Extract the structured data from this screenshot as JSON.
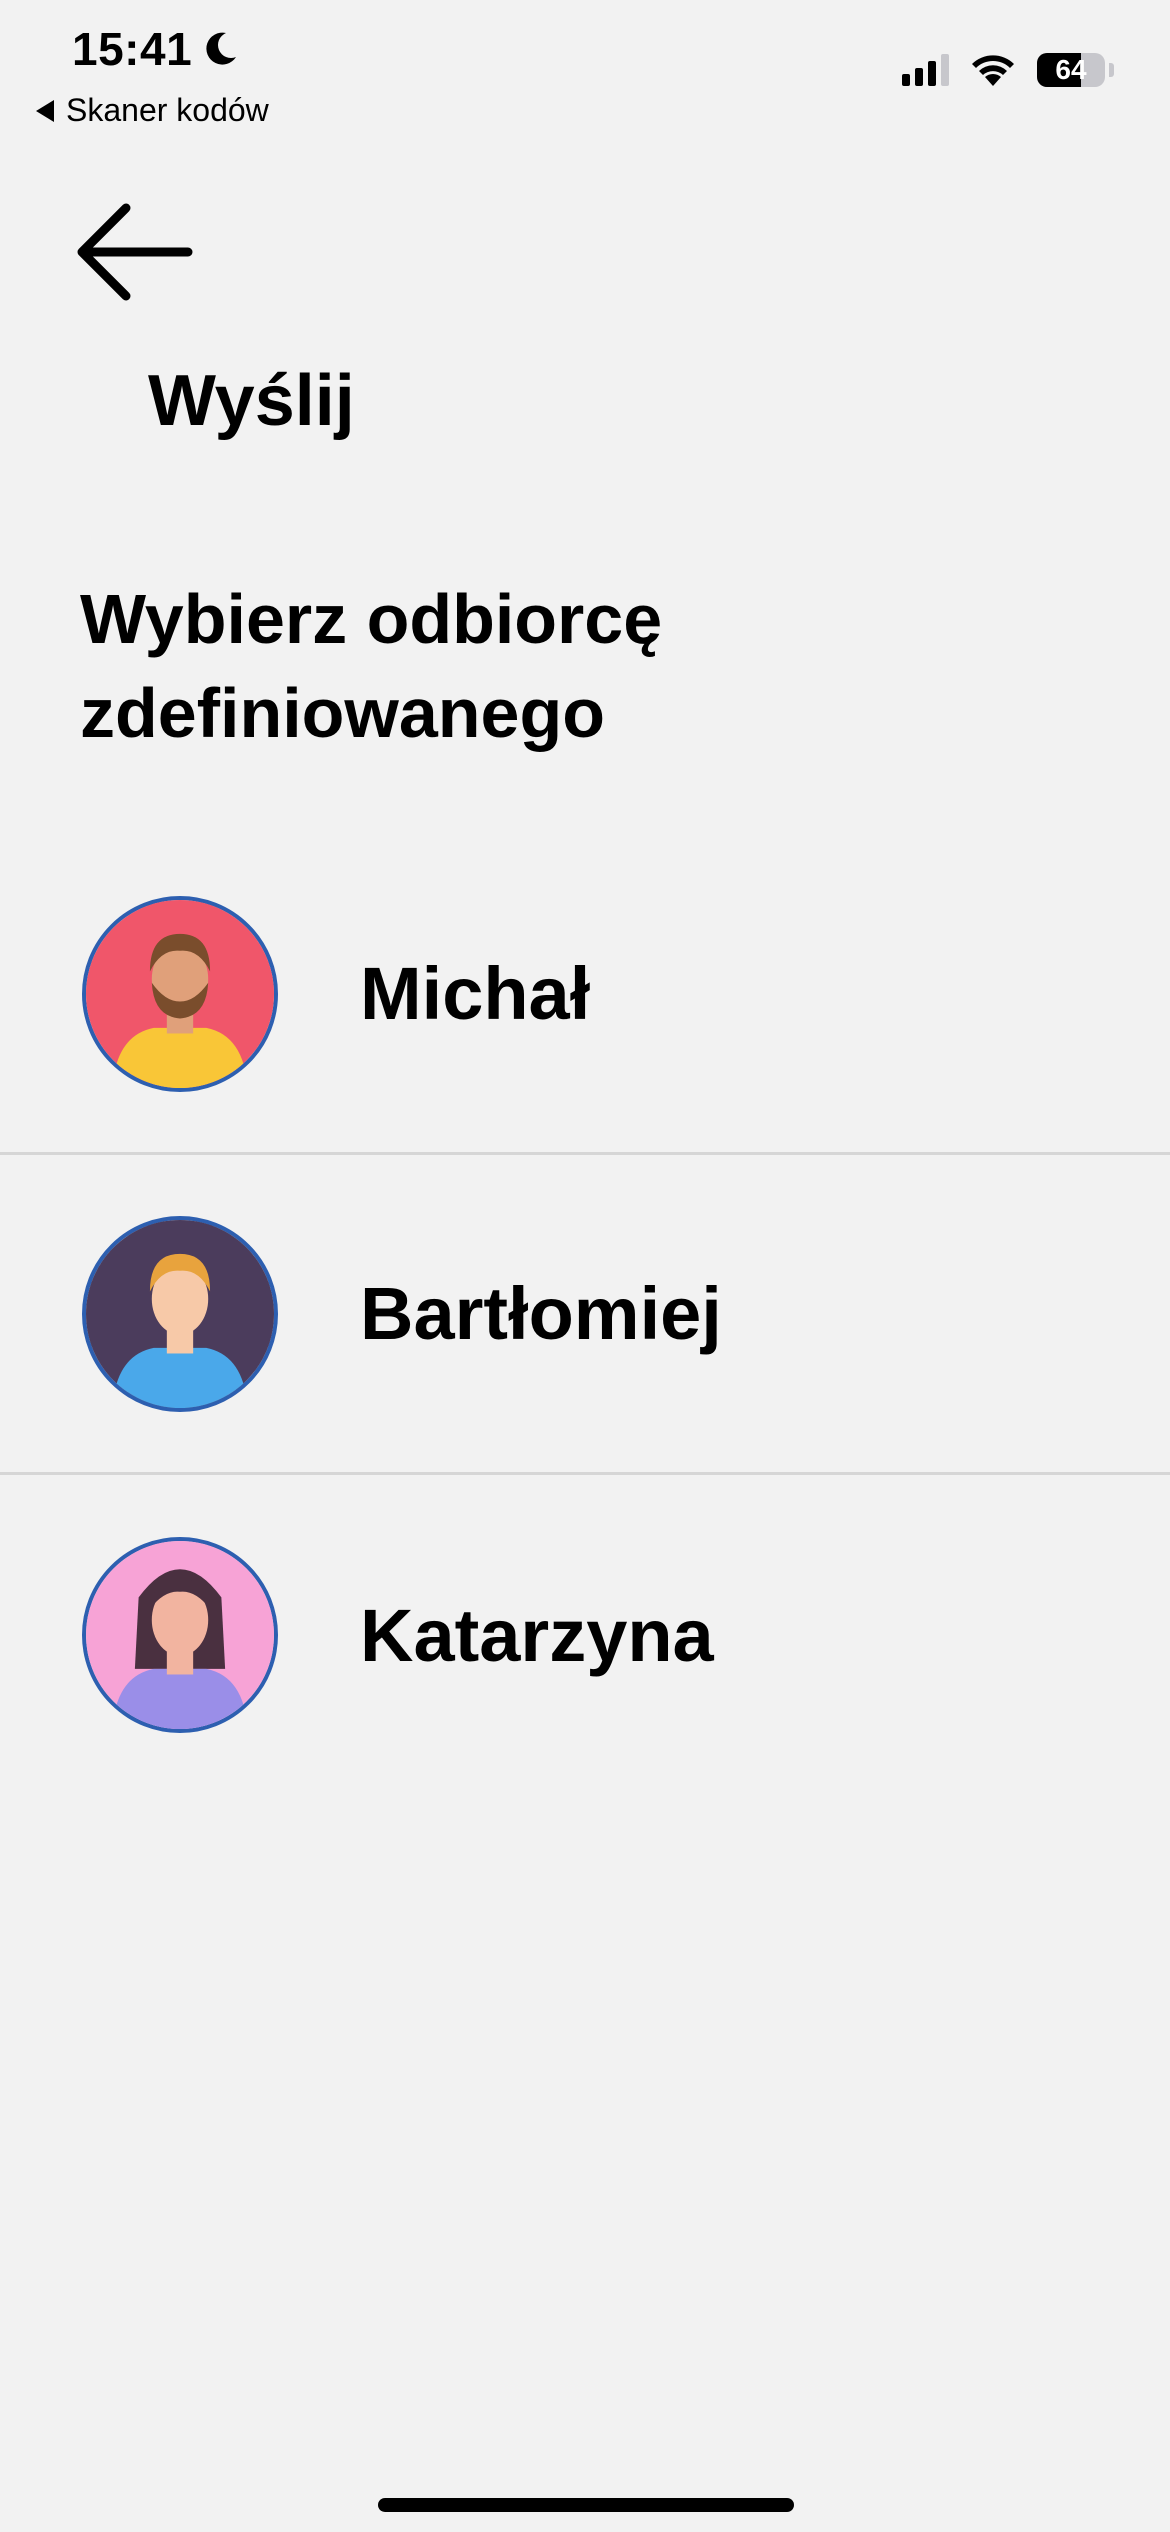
{
  "status_bar": {
    "time": "15:41",
    "back_app_label": "Skaner kodów",
    "battery_level": "64",
    "battery_fraction": 0.64,
    "signal_bars_active": 3,
    "icons": [
      "moon-icon",
      "cellular-signal-icon",
      "wifi-icon",
      "battery-icon"
    ]
  },
  "header": {
    "back_icon": "arrow-left-icon",
    "title": "Wyślij"
  },
  "section": {
    "title": "Wybierz odbiorcę zdefiniowanego"
  },
  "recipients": [
    {
      "name": "Michał",
      "avatar": "avatar-man-beard-icon",
      "bg": "#f0566a",
      "clothes": "#f9c637",
      "hair": "#7a4d2c",
      "skin": "#e0a07a"
    },
    {
      "name": "Bartłomiej",
      "avatar": "avatar-man-blond-icon",
      "bg": "#4b3c5c",
      "clothes": "#4aa8ea",
      "hair": "#e8a33d",
      "skin": "#f7c9a8"
    },
    {
      "name": "Katarzyna",
      "avatar": "avatar-woman-icon",
      "bg": "#f7a3d6",
      "clothes": "#9a8ee8",
      "hair": "#4a3040",
      "skin": "#f2b4a0"
    }
  ]
}
